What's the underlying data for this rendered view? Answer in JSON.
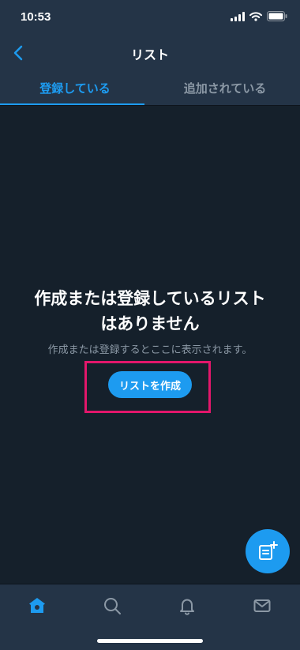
{
  "status_bar": {
    "time": "10:53"
  },
  "nav": {
    "title": "リスト",
    "back_icon": "chevron-left-icon"
  },
  "tabs": [
    {
      "label": "登録している",
      "active": true
    },
    {
      "label": "追加されている",
      "active": false
    }
  ],
  "empty_state": {
    "title_line1": "作成または登録しているリスト",
    "title_line2": "はありません",
    "subtitle": "作成または登録するとここに表示されます。",
    "button_label": "リストを作成"
  },
  "fab": {
    "icon": "new-list-icon"
  },
  "bottom_nav": [
    {
      "icon": "home-icon",
      "active": true
    },
    {
      "icon": "search-icon",
      "active": false
    },
    {
      "icon": "bell-icon",
      "active": false
    },
    {
      "icon": "mail-icon",
      "active": false
    }
  ],
  "colors": {
    "background": "#15202b",
    "header": "#243447",
    "accent": "#1d9bf0",
    "muted_text": "#8b98a5",
    "highlight": "#e2176b"
  }
}
